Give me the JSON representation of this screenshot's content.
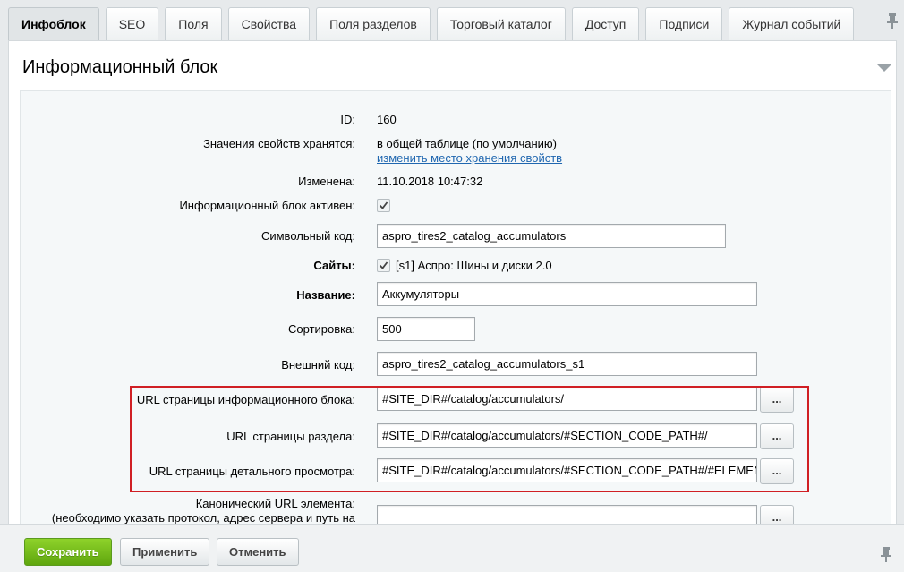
{
  "tabs": [
    {
      "label": "Инфоблок",
      "active": true
    },
    {
      "label": "SEO"
    },
    {
      "label": "Поля"
    },
    {
      "label": "Свойства"
    },
    {
      "label": "Поля разделов"
    },
    {
      "label": "Торговый каталог"
    },
    {
      "label": "Доступ"
    },
    {
      "label": "Подписи"
    },
    {
      "label": "Журнал событий"
    }
  ],
  "panel": {
    "title": "Информационный блок"
  },
  "fields": {
    "id": {
      "label": "ID:",
      "value": "160"
    },
    "storage": {
      "label": "Значения свойств хранятся:",
      "value": "в общей таблице (по умолчанию)",
      "link": "изменить место хранения свойств"
    },
    "modified": {
      "label": "Изменена:",
      "value": "11.10.2018 10:47:32"
    },
    "active": {
      "label": "Информационный блок активен:",
      "checked": true
    },
    "code": {
      "label": "Символьный код:",
      "value": "aspro_tires2_catalog_accumulators"
    },
    "sites": {
      "label": "Сайты:",
      "checked": true,
      "value": "[s1] Аспро: Шины и диски 2.0"
    },
    "name": {
      "label": "Название:",
      "value": "Аккумуляторы"
    },
    "sort": {
      "label": "Сортировка:",
      "value": "500"
    },
    "external_code": {
      "label": "Внешний код:",
      "value": "aspro_tires2_catalog_accumulators_s1"
    },
    "list_url": {
      "label": "URL страницы информационного блока:",
      "value": "#SITE_DIR#/catalog/accumulators/",
      "button": "..."
    },
    "section_url": {
      "label": "URL страницы раздела:",
      "value": "#SITE_DIR#/catalog/accumulators/#SECTION_CODE_PATH#/",
      "button": "..."
    },
    "detail_url": {
      "label": "URL страницы детального просмотра:",
      "value": "#SITE_DIR#/catalog/accumulators/#SECTION_CODE_PATH#/#ELEMENT_CODE#/",
      "button": "..."
    },
    "canonical_url": {
      "label_line1": "Канонический URL элемента:",
      "label_line2": "(необходимо указать протокол, адрес сервера и путь на",
      "value": "",
      "button": "..."
    }
  },
  "buttons": {
    "save": "Сохранить",
    "apply": "Применить",
    "cancel": "Отменить"
  },
  "colors": {
    "accent_green": "#6bb516",
    "link": "#2067b0",
    "highlight_red": "#d01f24"
  }
}
